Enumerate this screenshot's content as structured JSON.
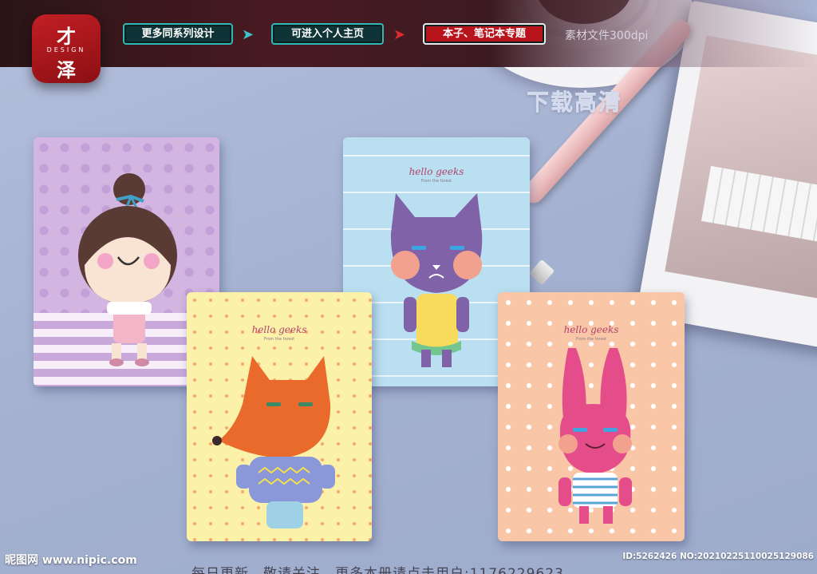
{
  "header": {
    "logo_top": "才",
    "logo_brand": "DESIGN",
    "logo_bottom": "泽",
    "buttons": [
      {
        "label": "更多同系列设计"
      },
      {
        "label": "可进入个人主页"
      },
      {
        "label": "本子、笔记本专题"
      }
    ],
    "spec": "素材文件300dpi"
  },
  "overlay": {
    "download_hd": "下载高清"
  },
  "notebooks": [
    {
      "id": "girl",
      "title": "",
      "subtitle": ""
    },
    {
      "id": "cat",
      "title": "hello geeks",
      "subtitle": "From the forest"
    },
    {
      "id": "fox",
      "title": "hello geeks",
      "subtitle": "From the forest"
    },
    {
      "id": "rabbit",
      "title": "hello geeks",
      "subtitle": "From the forest"
    }
  ],
  "watermark": {
    "left": "昵图网 www.nipic.com",
    "right": "ID:5262426 NO:20210225110025129086",
    "bottom": "每日更新，敬请关注，更多本册请点击用户:1176229623"
  },
  "colors": {
    "header_button_bg": "#0f3437",
    "header_button_border": "#2fb8b5",
    "header_button_red": "#b8141b",
    "logo_red": "#c21f25"
  }
}
